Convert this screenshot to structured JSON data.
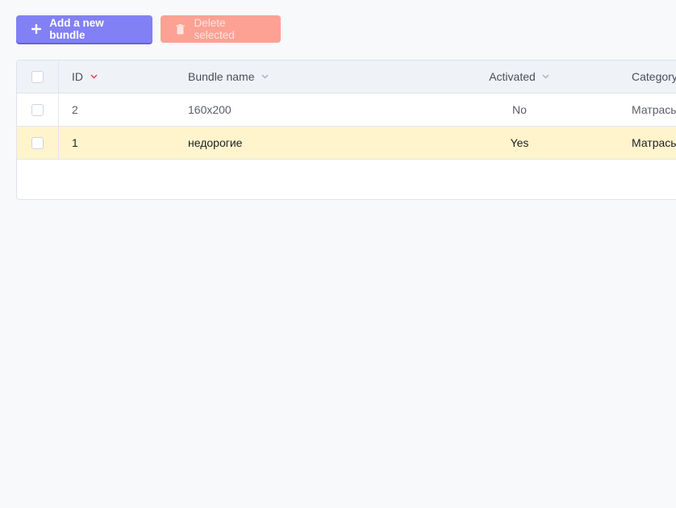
{
  "toolbar": {
    "add_label": "Add a new bundle",
    "delete_label": "Delete selected"
  },
  "colors": {
    "accent": "#8280f5",
    "danger": "#fca193",
    "highlight_row": "#fff4cc",
    "sort_active": "#e0394a"
  },
  "table": {
    "columns": {
      "id": "ID",
      "name": "Bundle name",
      "activated": "Activated",
      "category": "Category"
    },
    "rows": [
      {
        "id": "2",
        "name": "160x200",
        "activated": "No",
        "category": "Матрасы"
      },
      {
        "id": "1",
        "name": "недорогие",
        "activated": "Yes",
        "category": "Матрасы"
      }
    ]
  }
}
